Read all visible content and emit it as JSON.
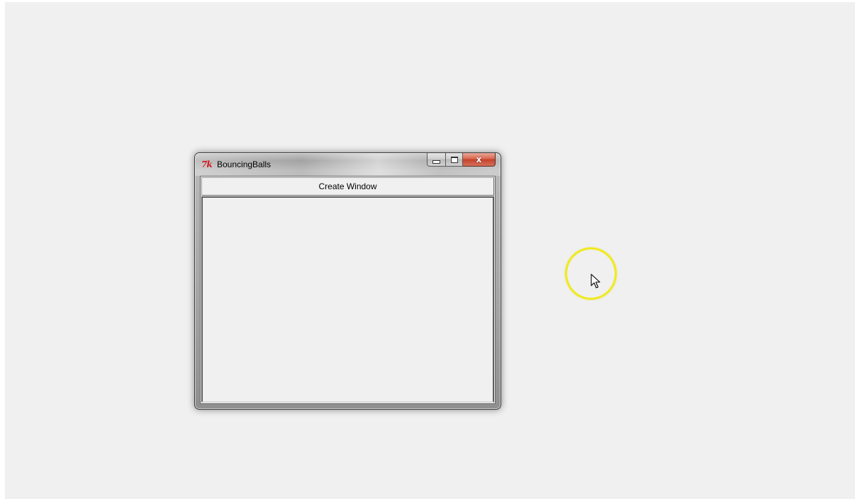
{
  "window": {
    "title": "BouncingBalls",
    "icon": "tk-feather-icon",
    "icon_text": "7k",
    "caption_buttons": {
      "minimize": "minimize-icon",
      "maximize": "maximize-icon",
      "close_label": "x"
    }
  },
  "client": {
    "create_button_label": "Create Window"
  },
  "colors": {
    "desktop": "#f0f0f0",
    "cursor_highlight": "#f0ea1e",
    "close_button": "#c4412a",
    "tk_icon": "#d11a1a"
  },
  "cursor": {
    "icon": "mouse-pointer-icon",
    "highlight": "cursor-highlight-ring"
  }
}
